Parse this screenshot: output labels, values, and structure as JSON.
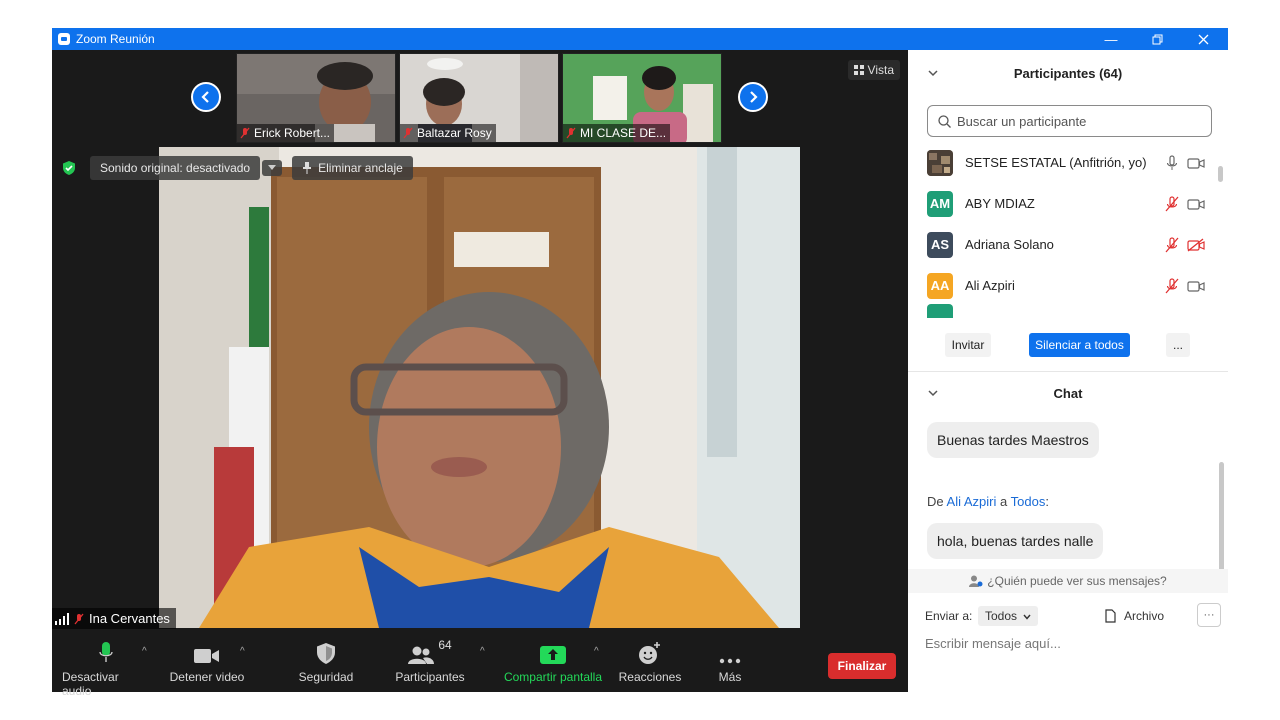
{
  "window": {
    "title": "Zoom Reunión"
  },
  "video": {
    "thumbnails": [
      {
        "name": "Erick Robert..."
      },
      {
        "name": "Baltazar Rosy"
      },
      {
        "name": "MI CLASE DE..."
      }
    ],
    "view_label": "Vista",
    "original_sound": "Sonido original: desactivado",
    "unpin_label": "Eliminar anclaje",
    "speaker_name": "Ina Cervantes"
  },
  "toolbar": {
    "mute": "Desactivar audio",
    "video": "Detener video",
    "security": "Seguridad",
    "participants": "Participantes",
    "participants_count": "64",
    "share": "Compartir pantalla",
    "reactions": "Reacciones",
    "more": "Más",
    "end": "Finalizar"
  },
  "participants_panel": {
    "title": "Participantes (64)",
    "search_placeholder": "Buscar un participante",
    "list": [
      {
        "name": "SETSE ESTATAL (Anfitrión, yo)",
        "initials": "",
        "color": "#6b5a4a",
        "mic": "on",
        "cam": "on"
      },
      {
        "name": "ABY MDIAZ",
        "initials": "AM",
        "color": "#1f9e77",
        "mic": "off",
        "cam": "on"
      },
      {
        "name": "Adriana Solano",
        "initials": "AS",
        "color": "#3d4b5c",
        "mic": "off",
        "cam": "off"
      },
      {
        "name": "Ali Azpiri",
        "initials": "AA",
        "color": "#f5a623",
        "mic": "off",
        "cam": "on"
      }
    ],
    "invite": "Invitar",
    "mute_all": "Silenciar a todos",
    "more": "..."
  },
  "chat": {
    "title": "Chat",
    "messages": [
      {
        "text": "Buenas tardes Maestros"
      },
      {
        "text": "hola, buenas tardes nalle"
      }
    ],
    "from_prefix": "De",
    "from_name": "Ali Azpiri",
    "to_word": "a",
    "to_name": "Todos",
    "who_can_see": "¿Quién puede ver sus mensajes?",
    "send_to_label": "Enviar a:",
    "send_to_value": "Todos",
    "file_label": "Archivo",
    "more": "···",
    "input_placeholder": "Escribir mensaje aquí..."
  },
  "colors": {
    "zoom_blue": "#0e72ed",
    "end_red": "#d92d2d",
    "share_green": "#23d959"
  }
}
